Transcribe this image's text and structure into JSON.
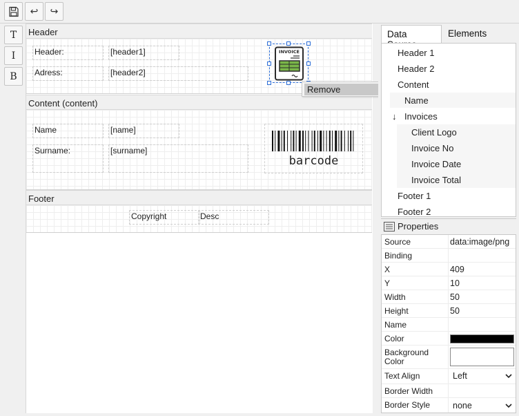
{
  "toolbar": {
    "save_icon": "floppy-disk-icon",
    "undo_icon": "undo-icon",
    "redo_icon": "redo-icon",
    "undo_glyph": "↩",
    "redo_glyph": "↪"
  },
  "side_tools": [
    {
      "name": "text-tool-button",
      "label": "T"
    },
    {
      "name": "image-tool-button",
      "label": "I"
    },
    {
      "name": "barcode-tool-button",
      "label": "B"
    }
  ],
  "bands": {
    "header": {
      "title": "Header",
      "fields": [
        "Header:",
        "[header1]",
        "Adress:",
        "[header2]"
      ],
      "image_text": "INVOICE"
    },
    "content": {
      "title": "Content (content)",
      "fields": [
        "Name",
        "[name]",
        "Surname:",
        "[surname]"
      ],
      "barcode_text": "barcode"
    },
    "footer": {
      "title": "Footer",
      "fields": [
        "Copyright",
        "Desc"
      ]
    }
  },
  "context_menu": {
    "items": [
      "Remove"
    ]
  },
  "panel": {
    "tabs": [
      "Data Source",
      "Elements"
    ],
    "tree": [
      "Header 1",
      "Header 2",
      "Content",
      "Name",
      "Invoices",
      "Client Logo",
      "Invoice No",
      "Invoice Date",
      "Invoice Total",
      "Footer 1",
      "Footer 2"
    ],
    "tree_arrow": "↓",
    "properties_title": "Properties",
    "properties": [
      {
        "name": "Source",
        "value": "data:image/png"
      },
      {
        "name": "Binding",
        "value": ""
      },
      {
        "name": "X",
        "value": "409"
      },
      {
        "name": "Y",
        "value": "10"
      },
      {
        "name": "Width",
        "value": "50"
      },
      {
        "name": "Height",
        "value": "50"
      },
      {
        "name": "Name",
        "value": ""
      },
      {
        "name": "Color",
        "value": "#000000"
      },
      {
        "name": "Background Color",
        "value": "#ffffff"
      },
      {
        "name": "Text Align",
        "value": "Left"
      },
      {
        "name": "Border Width",
        "value": ""
      },
      {
        "name": "Border Style",
        "value": "none"
      }
    ]
  },
  "colors": {
    "accent": "#2a6cd6",
    "invoice_green": "#7ab648",
    "menu_highlight": "#c8c8c8"
  }
}
